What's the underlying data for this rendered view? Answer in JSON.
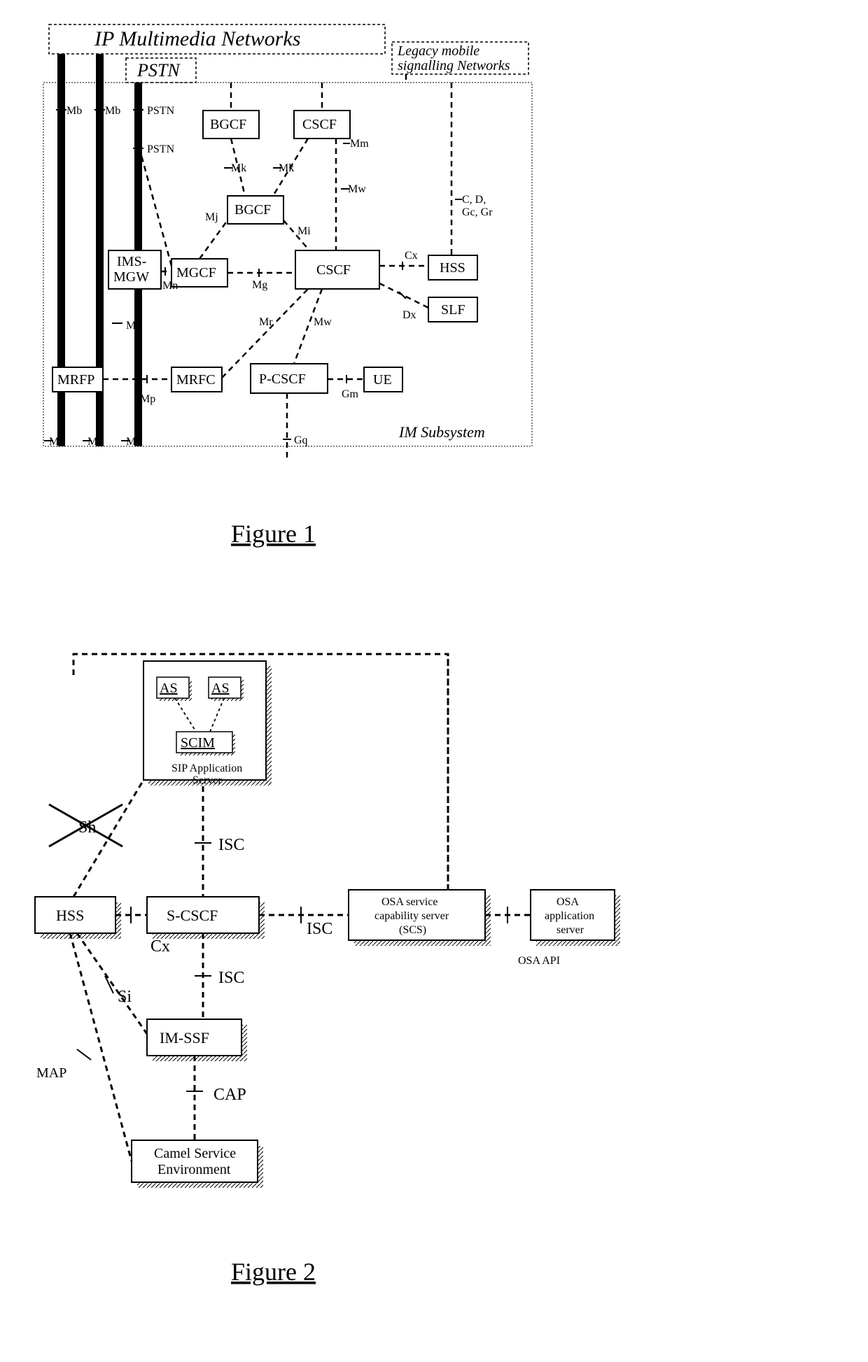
{
  "fig1": {
    "title": "Figure 1",
    "header": "IP Multimedia Networks",
    "pstn": "PSTN",
    "legacy1": "Legacy mobile",
    "legacy2": "signalling Networks",
    "subsystem": "IM Subsystem",
    "nodes": {
      "bgcf1": "BGCF",
      "cscf1": "CSCF",
      "bgcf2": "BGCF",
      "mgcf": "MGCF",
      "cscf2": "CSCF",
      "imsmgw1": "IMS-",
      "imsmgw2": "MGW",
      "hss": "HSS",
      "slf": "SLF",
      "mrfp": "MRFP",
      "mrfc": "MRFC",
      "pcscf": "P-CSCF",
      "ue": "UE"
    },
    "ifs": {
      "mb": "Mb",
      "pstn": "PSTN",
      "mk": "Mk",
      "mm": "Mm",
      "mw": "Mw",
      "mj": "Mj",
      "mi": "Mi",
      "cx": "Cx",
      "mn": "Mn",
      "mg": "Mg",
      "cdgcgr": "C, D,\nGc, Gr",
      "dx": "Dx",
      "mr": "Mr",
      "mp": "Mp",
      "gm": "Gm",
      "gq": "Gq"
    }
  },
  "fig2": {
    "title": "Figure 2",
    "nodes": {
      "as": "AS",
      "scim": "SCIM",
      "sipas1": "SIP Application",
      "sipas2": "Server",
      "hss": "HSS",
      "scscf": "S-CSCF",
      "imssf": "IM-SSF",
      "camel1": "Camel Service",
      "camel2": "Environment",
      "osascs1": "OSA service",
      "osascs2": "capability server",
      "osascs3": "(SCS)",
      "osaas1": "OSA",
      "osaas2": "application",
      "osaas3": "server",
      "osaapi": "OSA API"
    },
    "ifs": {
      "sh": "Sh",
      "isc": "ISC",
      "cx": "Cx",
      "si": "Si",
      "map": "MAP",
      "cap": "CAP"
    }
  }
}
